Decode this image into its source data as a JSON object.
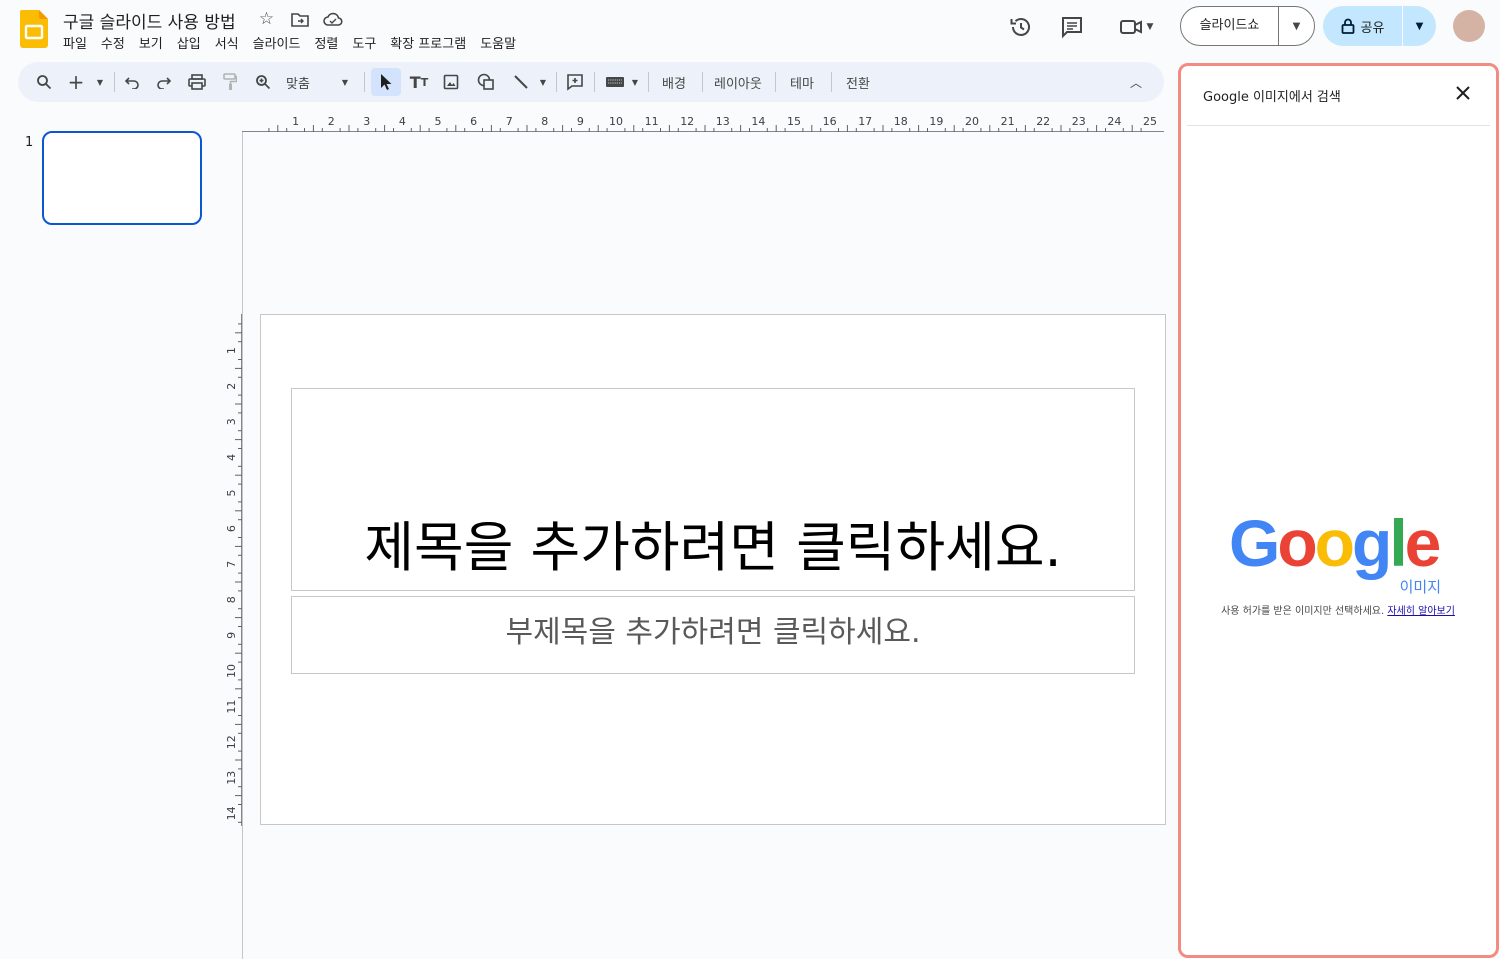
{
  "header": {
    "title": "구글 슬라이드 사용 방법",
    "menu": [
      "파일",
      "수정",
      "보기",
      "삽입",
      "서식",
      "슬라이드",
      "정렬",
      "도구",
      "확장 프로그램",
      "도움말"
    ],
    "slideshow_label": "슬라이드쇼",
    "share_label": "공유"
  },
  "toolbar": {
    "zoom_label": "맞춤",
    "background_label": "배경",
    "layout_label": "레이아웃",
    "theme_label": "테마",
    "transition_label": "전환"
  },
  "filmstrip": {
    "slide_number": "1"
  },
  "rulers": {
    "horizontal_labels": [
      "1",
      "2",
      "3",
      "4",
      "5",
      "6",
      "7",
      "8",
      "9",
      "10",
      "11",
      "12",
      "13",
      "14",
      "15",
      "16",
      "17",
      "18",
      "19",
      "20",
      "21",
      "22",
      "23",
      "24",
      "25"
    ],
    "vertical_labels": [
      "1",
      "2",
      "3",
      "4",
      "5",
      "6",
      "7",
      "8",
      "9",
      "10",
      "11",
      "12",
      "13",
      "14"
    ]
  },
  "slide": {
    "title_placeholder": "제목을 추가하려면 클릭하세요.",
    "subtitle_placeholder": "부제목을 추가하려면 클릭하세요."
  },
  "side_panel": {
    "title": "Google 이미지에서 검색",
    "logo_text": "Google",
    "logo_sub": "이미지",
    "description": "사용 허가를 받은 이미지만 선택하세요.",
    "learn_more": "자세히 알아보기"
  },
  "colors": {
    "accent": "#0b57d0",
    "share_bg": "#c2e7ff",
    "panel_border": "#f28b82"
  }
}
